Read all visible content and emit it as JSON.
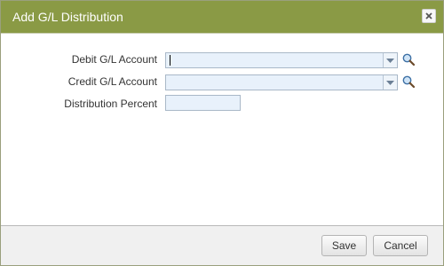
{
  "dialog": {
    "title": "Add G/L Distribution",
    "close_icon": "close-icon",
    "colors": {
      "titlebar": "#8a9a45",
      "field_background": "#e8f1fb"
    }
  },
  "form": {
    "debit_label": "Debit G/L Account",
    "debit_value": "",
    "credit_label": "Credit G/L Account",
    "credit_value": "",
    "percent_label": "Distribution Percent",
    "percent_value": "",
    "dropdown_icon": "chevron-down-icon",
    "lookup_icon": "search-icon"
  },
  "footer": {
    "save_label": "Save",
    "cancel_label": "Cancel"
  }
}
